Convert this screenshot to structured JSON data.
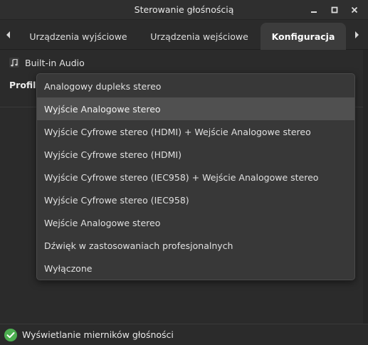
{
  "window": {
    "title": "Sterowanie głośnością"
  },
  "tabs": [
    {
      "label": "Urządzenia wyjściowe"
    },
    {
      "label": "Urządzenia wejściowe"
    },
    {
      "label": "Konfiguracja"
    }
  ],
  "device": {
    "name": "Built-in Audio",
    "icon": "music-note-icon"
  },
  "profile": {
    "label": "Profil:",
    "options": [
      "Analogowy dupleks stereo",
      "Wyjście Analogowe stereo",
      "Wyjście Cyfrowe stereo (HDMI) + Wejście Analogowe stereo",
      "Wyjście Cyfrowe stereo (HDMI)",
      "Wyjście Cyfrowe stereo (IEC958) + Wejście Analogowe stereo",
      "Wyjście Cyfrowe stereo (IEC958)",
      "Wejście Analogowe stereo",
      "Dźwięk w zastosowaniach profesjonalnych",
      "Wyłączone"
    ]
  },
  "footer": {
    "label": "Wyświetlanie mierników głośności"
  },
  "colors": {
    "check": "#4caf50",
    "highlight": "#505050",
    "active_tab": "#3c3c3c"
  }
}
